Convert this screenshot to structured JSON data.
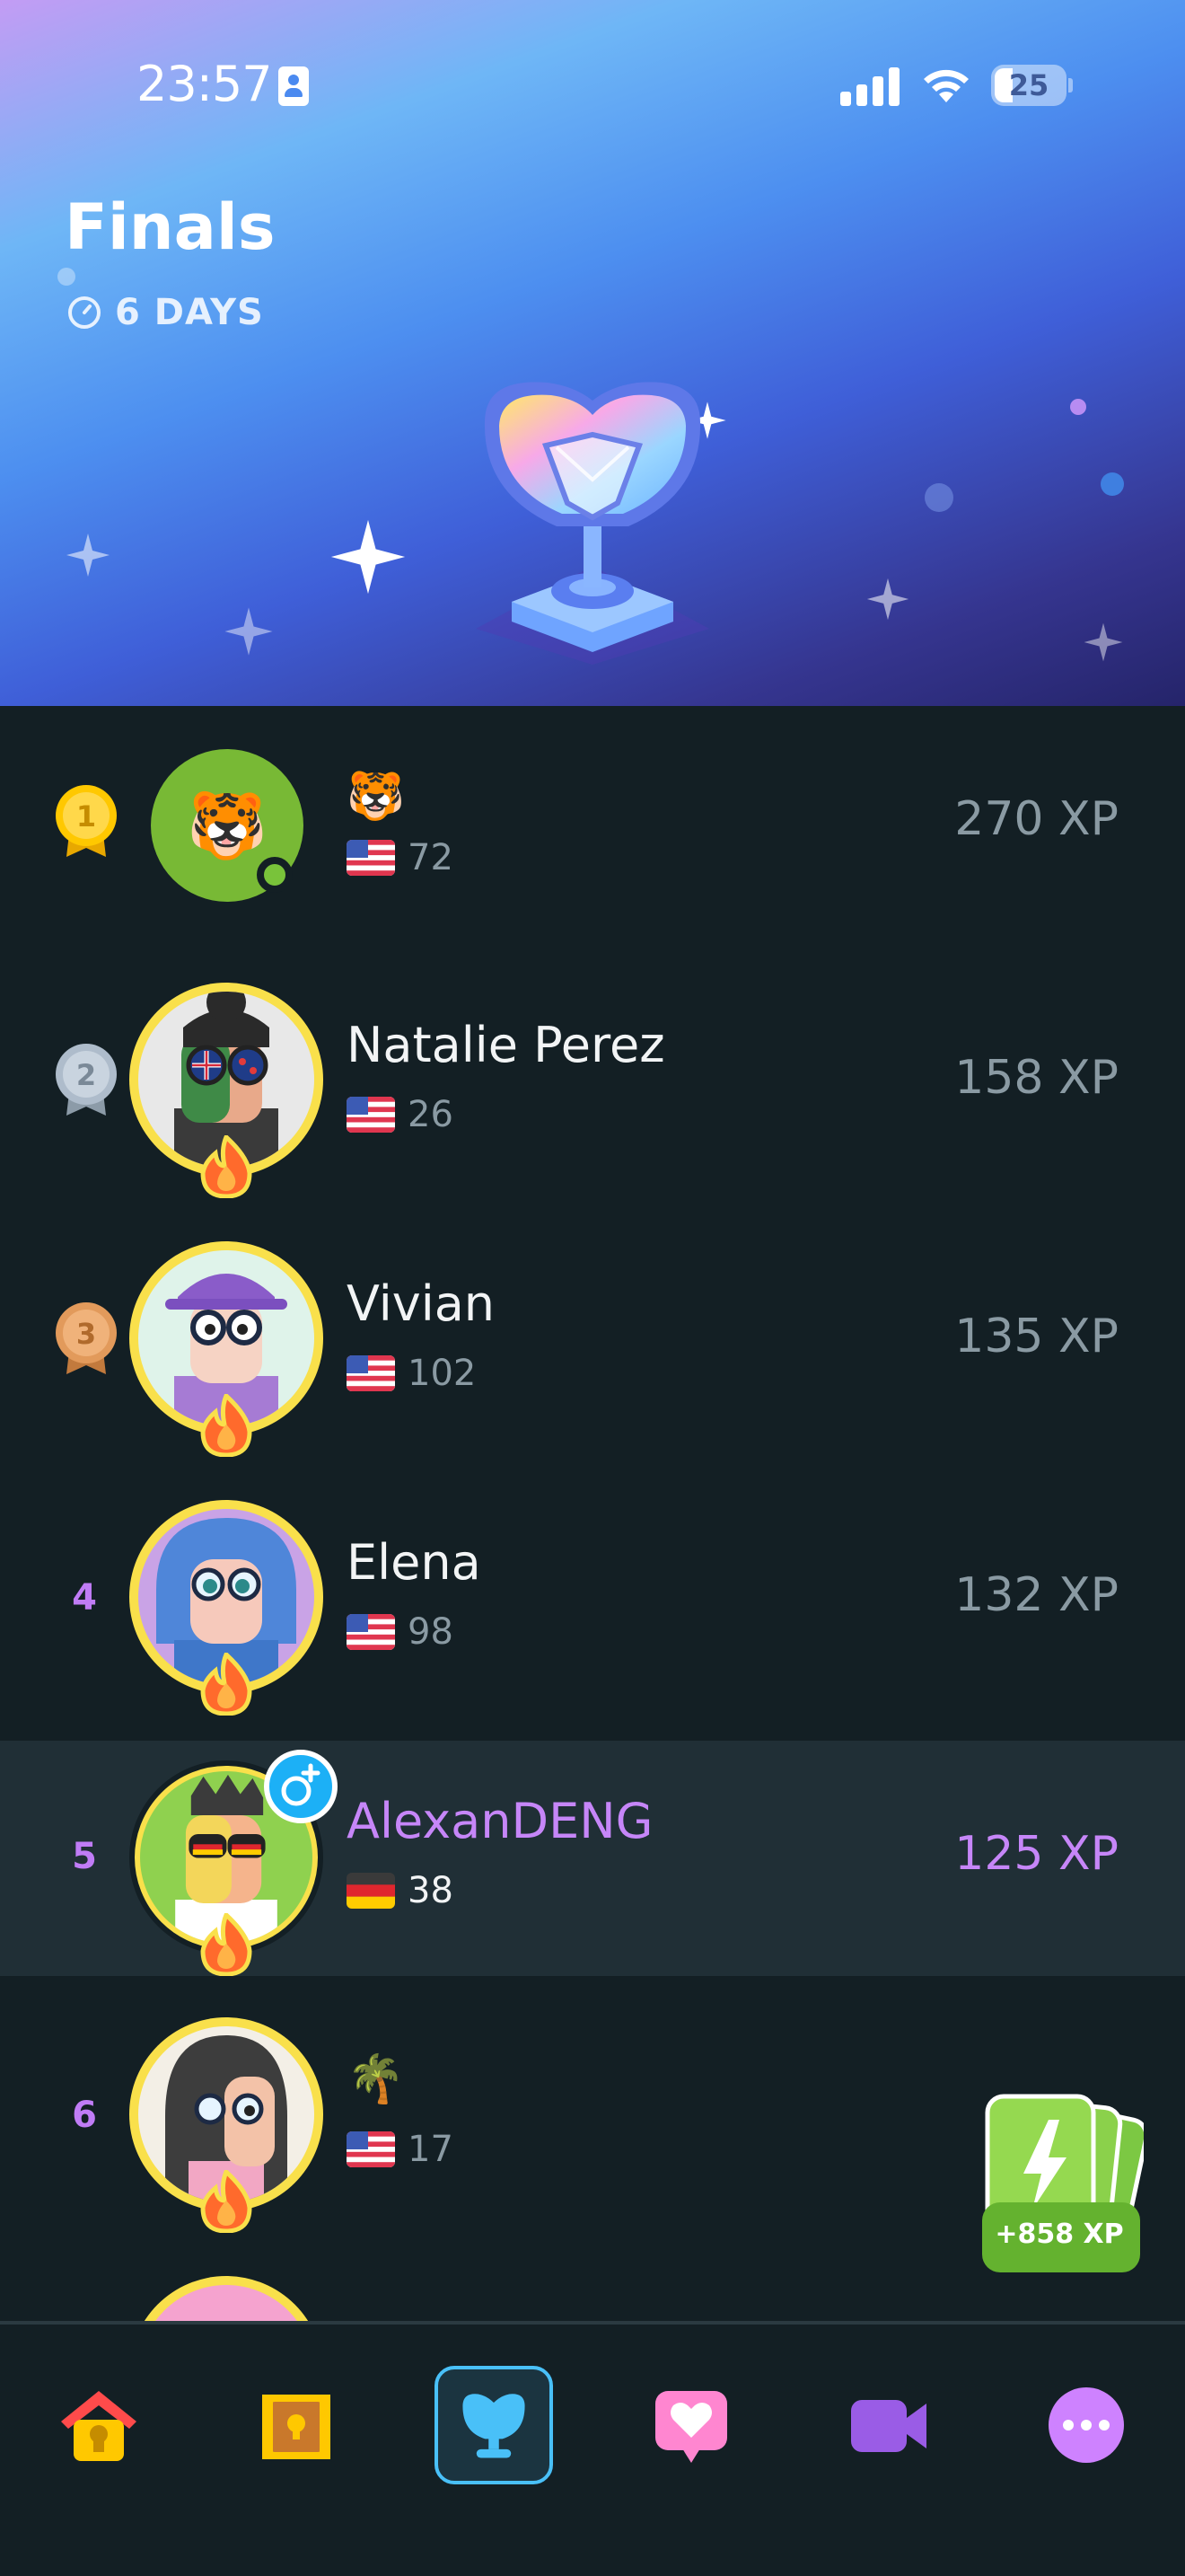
{
  "status_bar": {
    "time": "23:57",
    "battery": "25"
  },
  "header": {
    "title": "Finals",
    "time_left": "6 DAYS"
  },
  "leaderboard": [
    {
      "rank": "1",
      "medal": "gold",
      "name": "🐯",
      "flag": "us",
      "level": "72",
      "xp": "270 XP",
      "me": false
    },
    {
      "rank": "2",
      "medal": "silver",
      "name": "Natalie Perez",
      "flag": "us",
      "level": "26",
      "xp": "158 XP",
      "me": false
    },
    {
      "rank": "3",
      "medal": "bronze",
      "name": "Vivian",
      "flag": "us",
      "level": "102",
      "xp": "135 XP",
      "me": false
    },
    {
      "rank": "4",
      "medal": "",
      "name": "Elena",
      "flag": "us",
      "level": "98",
      "xp": "132 XP",
      "me": false
    },
    {
      "rank": "5",
      "medal": "",
      "name": "AlexanDENG",
      "flag": "de",
      "level": "38",
      "xp": "125 XP",
      "me": true
    },
    {
      "rank": "6",
      "medal": "",
      "name": "🌴",
      "flag": "us",
      "level": "17",
      "xp": "",
      "me": false
    }
  ],
  "boost_card": {
    "label": "+858 XP"
  },
  "tabs": [
    {
      "id": "learn",
      "icon": "home-icon",
      "active": false
    },
    {
      "id": "quests",
      "icon": "treasure-chest-icon",
      "active": false
    },
    {
      "id": "leaderboards",
      "icon": "trophy-icon",
      "active": true
    },
    {
      "id": "friends",
      "icon": "heart-message-icon",
      "active": false
    },
    {
      "id": "video",
      "icon": "video-camera-icon",
      "active": false
    },
    {
      "id": "more",
      "icon": "more-icon",
      "active": false
    }
  ],
  "colors": {
    "accent": "#c686f8",
    "background": "#131f24",
    "highlight_row": "#202f36",
    "tab_active": "#49c0f8"
  }
}
